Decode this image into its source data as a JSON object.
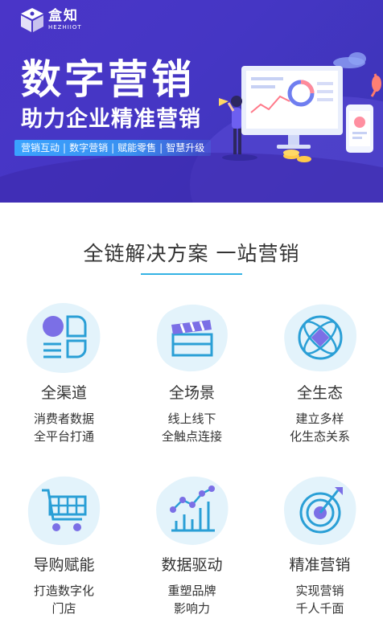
{
  "brand": {
    "name_cn": "盒知",
    "name_en": "HEZHIIOT"
  },
  "hero": {
    "title": "数字营销",
    "subtitle": "助力企业精准营销",
    "tags": [
      "营销互动",
      "数字营销",
      "赋能零售",
      "智慧升级"
    ],
    "tag_separator": "|"
  },
  "section": {
    "title": "全链解决方案 一站营销"
  },
  "features": [
    {
      "icon": "channels-icon",
      "title": "全渠道",
      "desc_line1": "消费者数据",
      "desc_line2": "全平台打通"
    },
    {
      "icon": "clapperboard-icon",
      "title": "全场景",
      "desc_line1": "线上线下",
      "desc_line2": "全触点连接"
    },
    {
      "icon": "atom-icon",
      "title": "全生态",
      "desc_line1": "建立多样",
      "desc_line2": "化生态关系"
    },
    {
      "icon": "shopping-cart-icon",
      "title": "导购赋能",
      "desc_line1": "打造数字化",
      "desc_line2": "门店"
    },
    {
      "icon": "line-chart-icon",
      "title": "数据驱动",
      "desc_line1": "重塑品牌",
      "desc_line2": "影响力"
    },
    {
      "icon": "target-icon",
      "title": "精准营销",
      "desc_line1": "实现营销",
      "desc_line2": "千人千面"
    }
  ],
  "colors": {
    "hero_bg": "#4536c4",
    "accent_blue": "#34b3e4",
    "icon_blue": "#2a9fd6",
    "icon_purple": "#7b6fe6",
    "blob": "#e3f3fb"
  }
}
